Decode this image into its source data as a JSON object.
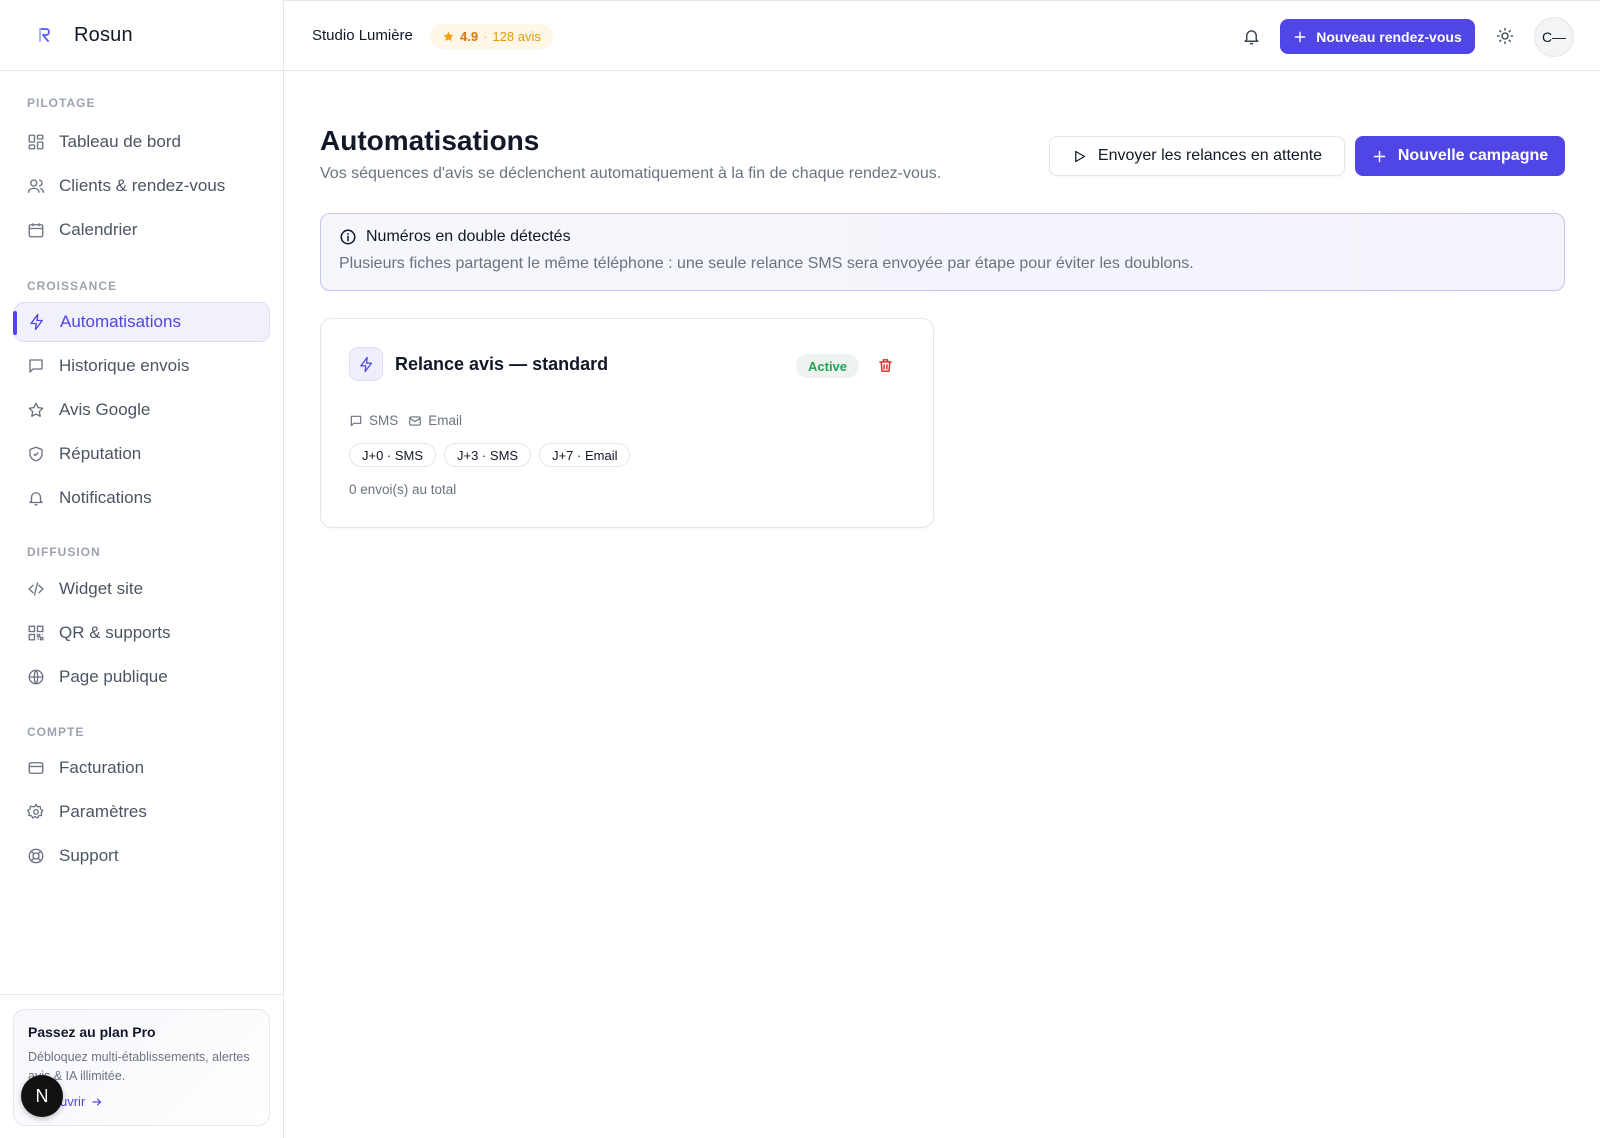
{
  "brand": {
    "name": "Rosun",
    "logo_icon": "rosun-logo"
  },
  "sidebar": {
    "sections": [
      {
        "label": "PILOTAGE"
      },
      {
        "label": "CROISSANCE"
      },
      {
        "label": "DIFFUSION"
      },
      {
        "label": "COMPTE"
      }
    ],
    "items": [
      {
        "label": "Tableau de bord",
        "icon": "dashboard-icon"
      },
      {
        "label": "Clients & rendez-vous",
        "icon": "users-icon"
      },
      {
        "label": "Calendrier",
        "icon": "calendar-icon"
      },
      {
        "label": "Automatisations",
        "icon": "zap-icon",
        "active": true
      },
      {
        "label": "Historique envois",
        "icon": "message-icon"
      },
      {
        "label": "Avis Google",
        "icon": "star-icon"
      },
      {
        "label": "Réputation",
        "icon": "shield-icon"
      },
      {
        "label": "Notifications",
        "icon": "bell-icon"
      },
      {
        "label": "Widget site",
        "icon": "code-icon"
      },
      {
        "label": "QR & supports",
        "icon": "qr-icon"
      },
      {
        "label": "Page publique",
        "icon": "globe-icon"
      },
      {
        "label": "Facturation",
        "icon": "credit-card-icon"
      },
      {
        "label": "Paramètres",
        "icon": "gear-icon"
      },
      {
        "label": "Support",
        "icon": "lifebuoy-icon"
      }
    ],
    "promo": {
      "title": "Passez au plan Pro",
      "text": "Débloquez multi-établissements, alertes avis & IA illimitée.",
      "link": "uvrir"
    },
    "n_badge": "N"
  },
  "topbar": {
    "studio_name": "Studio Lumière",
    "rating": "4.9",
    "rating_sep": "·",
    "reviews": "128 avis",
    "new_appointment": "Nouveau rendez-vous",
    "avatar": "C—"
  },
  "main": {
    "title": "Automatisations",
    "subtitle": "Vos séquences d'avis se déclenchent automatiquement à la fin de chaque rendez-vous.",
    "send_button": "Envoyer les relances en attente",
    "new_campaign_button": "Nouvelle campagne",
    "alert": {
      "title": "Numéros en double détectés",
      "text": "Plusieurs fiches partagent le même téléphone : une seule relance SMS sera envoyée par étape pour éviter les doublons."
    },
    "campaign": {
      "title": "Relance avis — standard",
      "status": "Active",
      "status_color": "#22a35a",
      "channels": [
        "SMS",
        "Email"
      ],
      "steps": [
        "J+0 · SMS",
        "J+3 · SMS",
        "J+7 · Email"
      ],
      "total": "0 envoi(s) au total"
    }
  },
  "colors": {
    "accent": "#4f46e5",
    "danger": "#dc2626",
    "rating": "#f59e0b"
  }
}
